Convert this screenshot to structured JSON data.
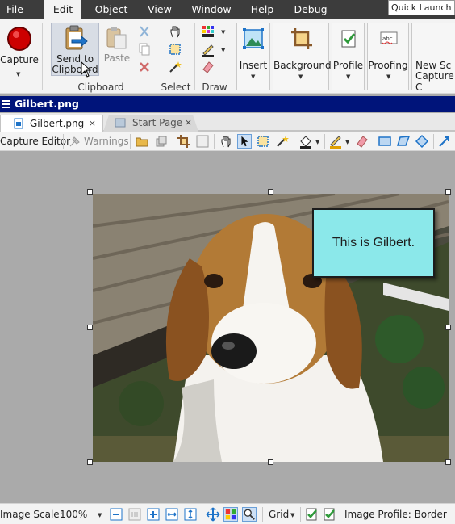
{
  "menu": {
    "items": [
      "File",
      "Edit",
      "Object",
      "View",
      "Window",
      "Help",
      "Debug"
    ],
    "active": "Edit",
    "quick_launch_placeholder": "Quick Launch (C"
  },
  "ribbon": {
    "capture_label": "Capture",
    "send_to_clipboard_line1": "Send to",
    "send_to_clipboard_line2": "Clipboard",
    "paste_label": "Paste",
    "clipboard_group": "Clipboard",
    "select_group": "Select",
    "draw_group": "Draw",
    "insert_label": "Insert",
    "background_label": "Background",
    "profile_label": "Profile",
    "proofing_label": "Proofing",
    "new_snagit_line1": "New Sc",
    "new_snagit_line2": "Capture C"
  },
  "document": {
    "title": "Gilbert.png",
    "tabs": [
      {
        "label": "Gilbert.png",
        "close": "×",
        "active": true
      },
      {
        "label": "Start Page",
        "close": "×",
        "active": false
      }
    ]
  },
  "editor_toolbar": {
    "capture_editor_label": "Capture Editor",
    "warnings_label": "Warnings"
  },
  "canvas": {
    "callout_text": "This is Gilbert.",
    "callout_fill": "#8be8ea"
  },
  "statusbar": {
    "image_scale_label": "Image Scale:",
    "zoom_value": "100%",
    "grid_label": "Grid",
    "image_profile_label": "Image Profile: Border"
  },
  "colors": {
    "menubar_bg": "#3c3c3c",
    "doc_title_bg": "#00147a",
    "canvas_bg": "#aaaaaa",
    "accent_blue": "#1e73c8",
    "capture_red": "#cc0000"
  }
}
